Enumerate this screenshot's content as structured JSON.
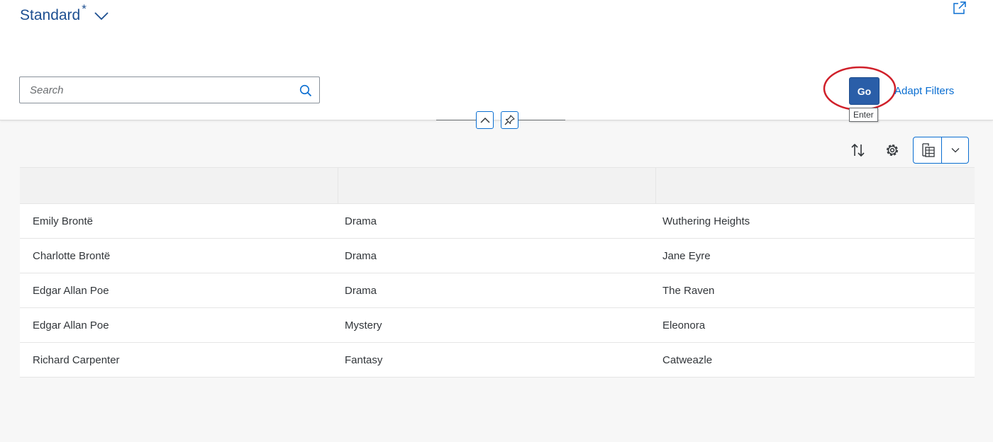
{
  "variant": {
    "title": "Standard",
    "modified_marker": "*"
  },
  "search": {
    "placeholder": "Search",
    "value": ""
  },
  "filterbar": {
    "go_label": "Go",
    "go_tooltip": "Enter",
    "adapt_filters_label": "Adapt Filters"
  },
  "icons": {
    "variant_dropdown": "chevron-down-icon",
    "share": "share-icon",
    "search": "search-icon",
    "collapse": "chevron-up-icon",
    "pin": "pin-icon",
    "sort": "sort-icon",
    "settings": "gear-icon",
    "export": "spreadsheet-export-icon",
    "export_menu": "chevron-down-icon"
  },
  "colors": {
    "accent": "#0a6ed1",
    "title": "#1d4f91",
    "go_button": "#2a5ea8",
    "highlight_annotation": "#d0202a"
  },
  "table": {
    "columns": [
      "",
      "",
      ""
    ],
    "rows": [
      [
        "Emily Brontë",
        "Drama",
        "Wuthering Heights"
      ],
      [
        "Charlotte Brontë",
        "Drama",
        "Jane Eyre"
      ],
      [
        "Edgar Allan Poe",
        "Drama",
        "The Raven"
      ],
      [
        "Edgar Allan Poe",
        "Mystery",
        "Eleonora"
      ],
      [
        "Richard Carpenter",
        "Fantasy",
        "Catweazle"
      ]
    ]
  }
}
